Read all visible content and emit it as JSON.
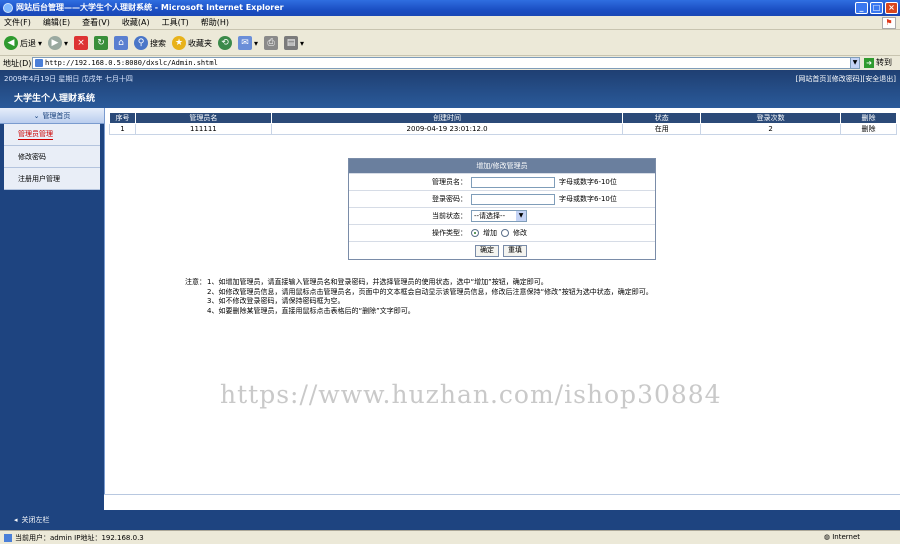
{
  "window": {
    "title": "网站后台管理——大学生个人理财系统 - Microsoft Internet Explorer",
    "controls": [
      "_",
      "□",
      "×"
    ]
  },
  "menubar": [
    "文件(F)",
    "编辑(E)",
    "查看(V)",
    "收藏(A)",
    "工具(T)",
    "帮助(H)"
  ],
  "toolbar": {
    "back": "后退",
    "search": "搜索",
    "favorites": "收藏夹"
  },
  "address": {
    "label": "地址(D)",
    "url": "http://192.168.0.5:8080/dxslc/Admin.shtml",
    "go": "转到"
  },
  "header": {
    "date_line": "2009年4月19日 星期日 戊戌年 七月十四",
    "links": [
      "[网站首页]",
      "[修改密码]",
      "[安全退出]"
    ],
    "title": "大学生个人理财系统"
  },
  "sidebar": {
    "head": "管理首页",
    "items": [
      "管理员管理",
      "修改密码",
      "注册用户管理"
    ]
  },
  "table": {
    "headers": [
      "序号",
      "管理员名",
      "创建时间",
      "状态",
      "登录次数",
      "删除"
    ],
    "rows": [
      [
        "1",
        "111111",
        "2009-04-19 23:01:12.0",
        "在用",
        "2",
        "删除"
      ]
    ]
  },
  "form": {
    "title": "增加/修改管理员",
    "username_label": "管理员名：",
    "username_hint": "字母或数字6-10位",
    "password_label": "登录密码：",
    "password_hint": "字母或数字6-10位",
    "status_label": "当前状态：",
    "status_value": "--请选择--",
    "op_label": "操作类型：",
    "op_add": "增加",
    "op_modify": "修改",
    "submit": "确定",
    "reset": "重填"
  },
  "notes": {
    "lead": "注意：",
    "lines": [
      "1、如增加管理员，请直接输入管理员名和登录密码，并选择管理员的使用状态，选中“增加”按钮，确定即可。",
      "2、如修改管理员信息，请用鼠标点击管理员名，页面中的文本框会自动显示该管理员信息，修改后注意保持“修改”按钮为选中状态，确定即可。",
      "3、如不修改登录密码，请保持密码框为空。",
      "4、如要删除某管理员，直接用鼠标点击表格后的“删除”文字即可。"
    ]
  },
  "watermark": "https://www.huzhan.com/ishop30884",
  "closebar": {
    "label": "关闭左栏"
  },
  "status": {
    "left": "当前用户：admin  IP地址：192.168.0.3",
    "zone": "Internet"
  }
}
